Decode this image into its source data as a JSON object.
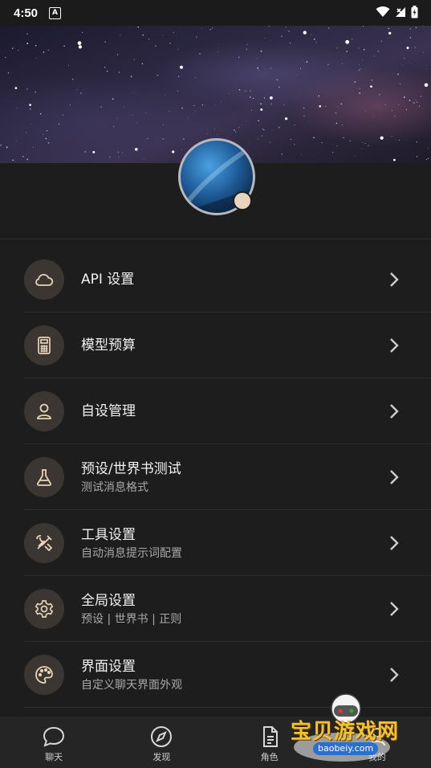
{
  "status_bar": {
    "time": "4:50",
    "app_badge": "A"
  },
  "menu": [
    {
      "title": "API 设置",
      "subtitle": "",
      "icon": "cloud-icon"
    },
    {
      "title": "模型预算",
      "subtitle": "",
      "icon": "calculator-icon"
    },
    {
      "title": "自设管理",
      "subtitle": "",
      "icon": "user-icon"
    },
    {
      "title": "预设/世界书测试",
      "subtitle": "测试消息格式",
      "icon": "flask-icon"
    },
    {
      "title": "工具设置",
      "subtitle": "自动消息提示词配置",
      "icon": "tools-icon"
    },
    {
      "title": "全局设置",
      "subtitle": "预设 | 世界书 | 正则",
      "icon": "gear-icon"
    },
    {
      "title": "界面设置",
      "subtitle": "自定义聊天界面外观",
      "icon": "palette-icon"
    }
  ],
  "nav": [
    {
      "label": "聊天",
      "icon": "chat-icon"
    },
    {
      "label": "发现",
      "icon": "compass-icon"
    },
    {
      "label": "角色",
      "icon": "document-icon"
    },
    {
      "label": "我的",
      "icon": "profile-icon"
    }
  ],
  "watermark": {
    "text": "宝贝游戏网",
    "url": "baobeiy.com"
  },
  "colors": {
    "accent": "#e8d3b6",
    "icon_bg": "#3b3632",
    "background": "#1d1d1d"
  }
}
